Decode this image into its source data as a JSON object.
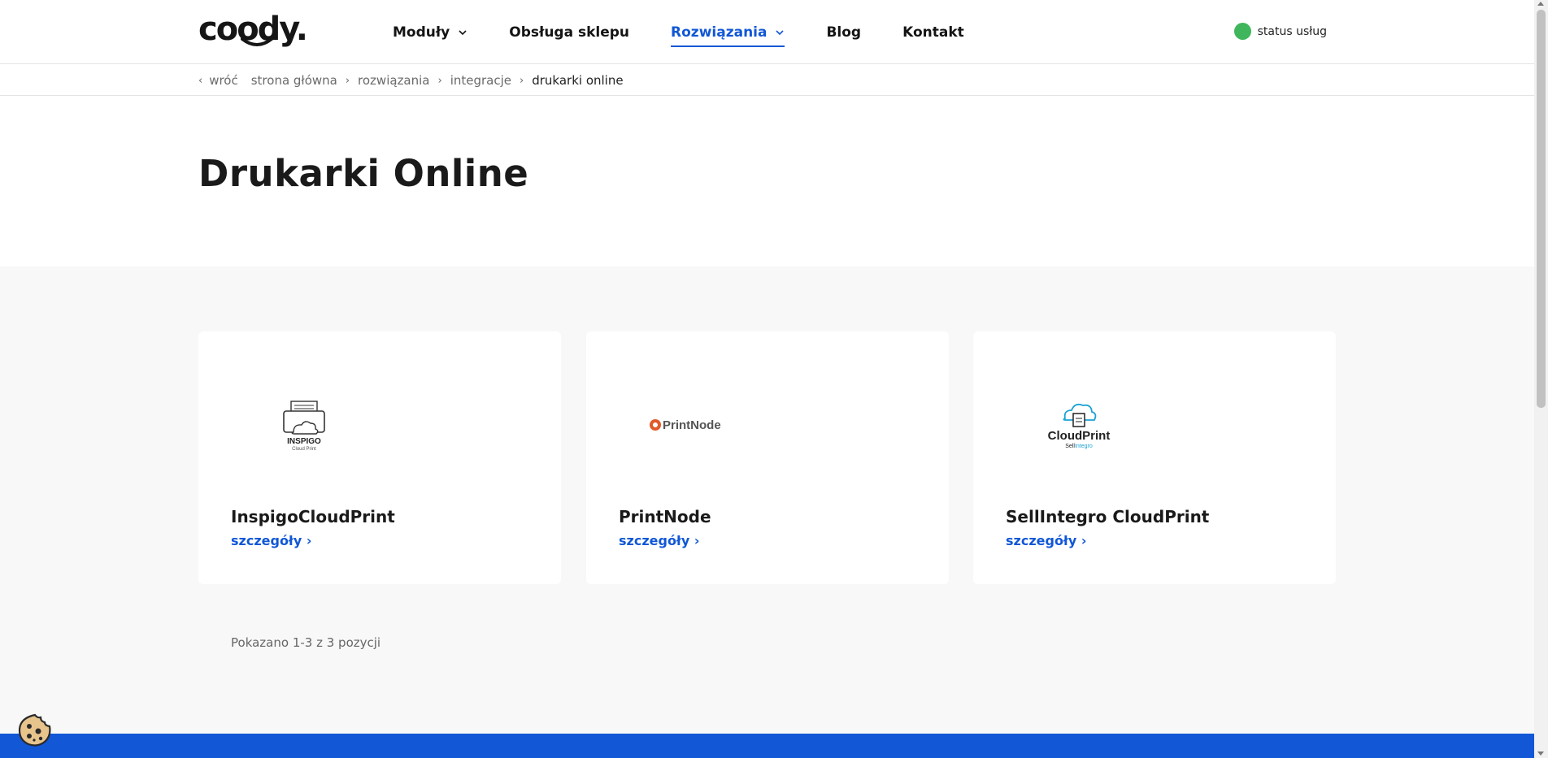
{
  "header": {
    "logo_text": "coody.",
    "nav": [
      {
        "label": "Moduły",
        "has_dropdown": true,
        "active": false
      },
      {
        "label": "Obsługa sklepu",
        "has_dropdown": false,
        "active": false
      },
      {
        "label": "Rozwiązania",
        "has_dropdown": true,
        "active": true
      },
      {
        "label": "Blog",
        "has_dropdown": false,
        "active": false
      },
      {
        "label": "Kontakt",
        "has_dropdown": false,
        "active": false
      }
    ],
    "status_label": "status usług",
    "status_color": "#3fb65b"
  },
  "breadcrumb": {
    "back_label": "wróć",
    "items": [
      "strona główna",
      "rozwiązania",
      "integracje",
      "drukarki online"
    ]
  },
  "page": {
    "title": "Drukarki Online"
  },
  "cards": [
    {
      "name": "InspigoCloudPrint",
      "link": "szczegóły",
      "logo_text": "INSPIGO",
      "logo_sub": "Cloud Print"
    },
    {
      "name": "PrintNode",
      "link": "szczegóły",
      "logo_text": "PrintNode"
    },
    {
      "name": "SellIntegro CloudPrint",
      "link": "szczegóły",
      "logo_text": "CloudPrint",
      "logo_sub_a": "Sell",
      "logo_sub_b": "Integro"
    }
  ],
  "pagination": {
    "info": "Pokazano 1-3 z 3 pozycji"
  },
  "colors": {
    "accent": "#1157d6",
    "background_gray": "#f8f8f8"
  }
}
